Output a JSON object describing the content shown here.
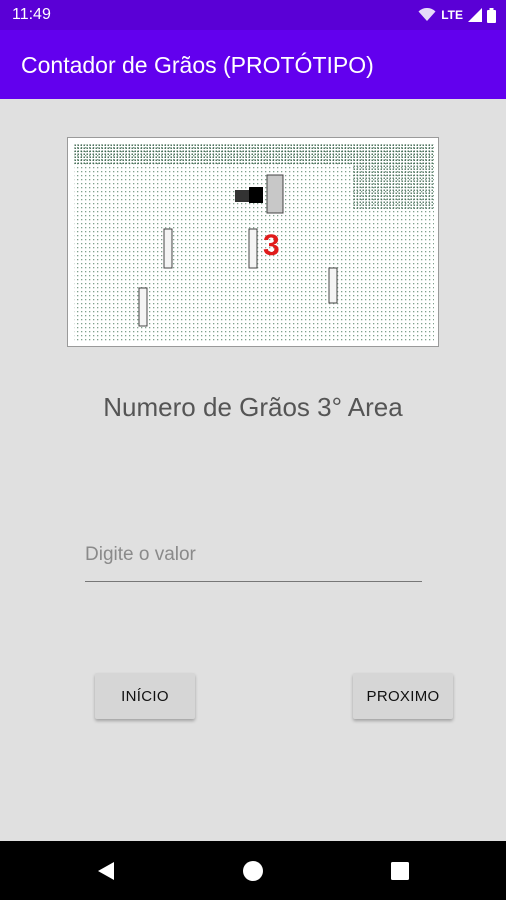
{
  "status_bar": {
    "time": "11:49",
    "network": "LTE",
    "icons": [
      "wifi-icon",
      "signal-icon",
      "battery-icon"
    ]
  },
  "app_bar": {
    "title": "Contador de Grãos (PROTÓTIPO)",
    "color": "#6200ee"
  },
  "illustration": {
    "area_number": "3",
    "marker_color": "#e01b1b"
  },
  "main": {
    "heading": "Numero de Grãos 3° Area",
    "input": {
      "placeholder": "Digite o valor",
      "value": ""
    }
  },
  "buttons": {
    "inicio_label": "INÍCIO",
    "proximo_label": "PROXIMO"
  },
  "nav_bar": {
    "icons": [
      "back-icon",
      "home-icon",
      "recents-icon"
    ]
  }
}
